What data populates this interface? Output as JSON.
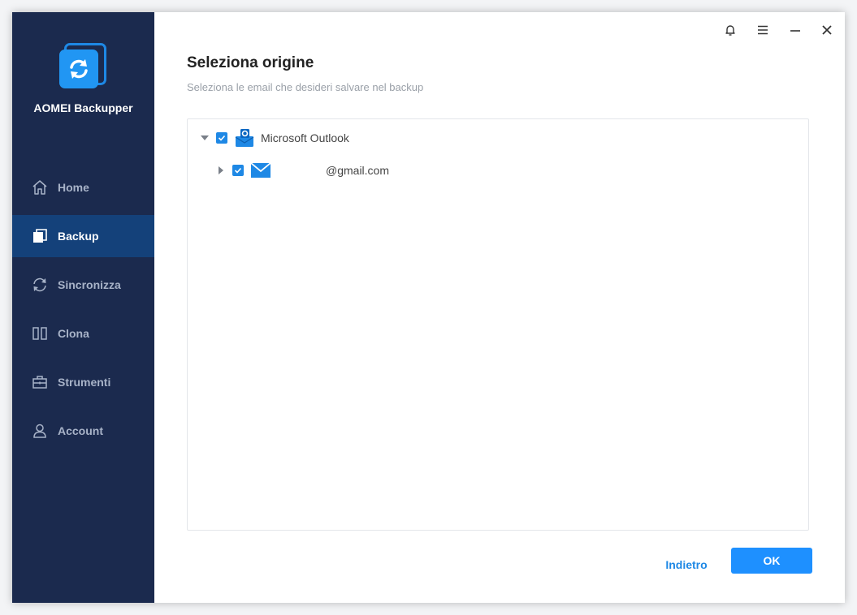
{
  "app": {
    "name": "AOMEI Backupper"
  },
  "sidebar": {
    "items": [
      {
        "label": "Home",
        "icon": "home-icon",
        "active": false
      },
      {
        "label": "Backup",
        "icon": "backup-icon",
        "active": true
      },
      {
        "label": "Sincronizza",
        "icon": "sync-icon",
        "active": false
      },
      {
        "label": "Clona",
        "icon": "clone-icon",
        "active": false
      },
      {
        "label": "Strumenti",
        "icon": "toolbox-icon",
        "active": false
      },
      {
        "label": "Account",
        "icon": "user-icon",
        "active": false
      }
    ]
  },
  "titlebar": {
    "icons": [
      "bell-icon",
      "menu-icon",
      "minimize-icon",
      "close-icon"
    ]
  },
  "main": {
    "title": "Seleziona origine",
    "subtitle": "Seleziona le email che desideri salvare nel backup",
    "tree": {
      "root": {
        "label": "Microsoft Outlook",
        "checked": true,
        "expanded": true,
        "icon": "outlook-icon"
      },
      "child": {
        "label": "@gmail.com",
        "checked": true,
        "expanded": false,
        "icon": "mail-icon"
      }
    }
  },
  "buttons": {
    "back_label": "Indietro",
    "ok_label": "OK"
  },
  "colors": {
    "sidebar_bg": "#1b2a4e",
    "sidebar_active": "#14417a",
    "accent": "#1e88e5",
    "ok_button": "#1e90ff"
  }
}
